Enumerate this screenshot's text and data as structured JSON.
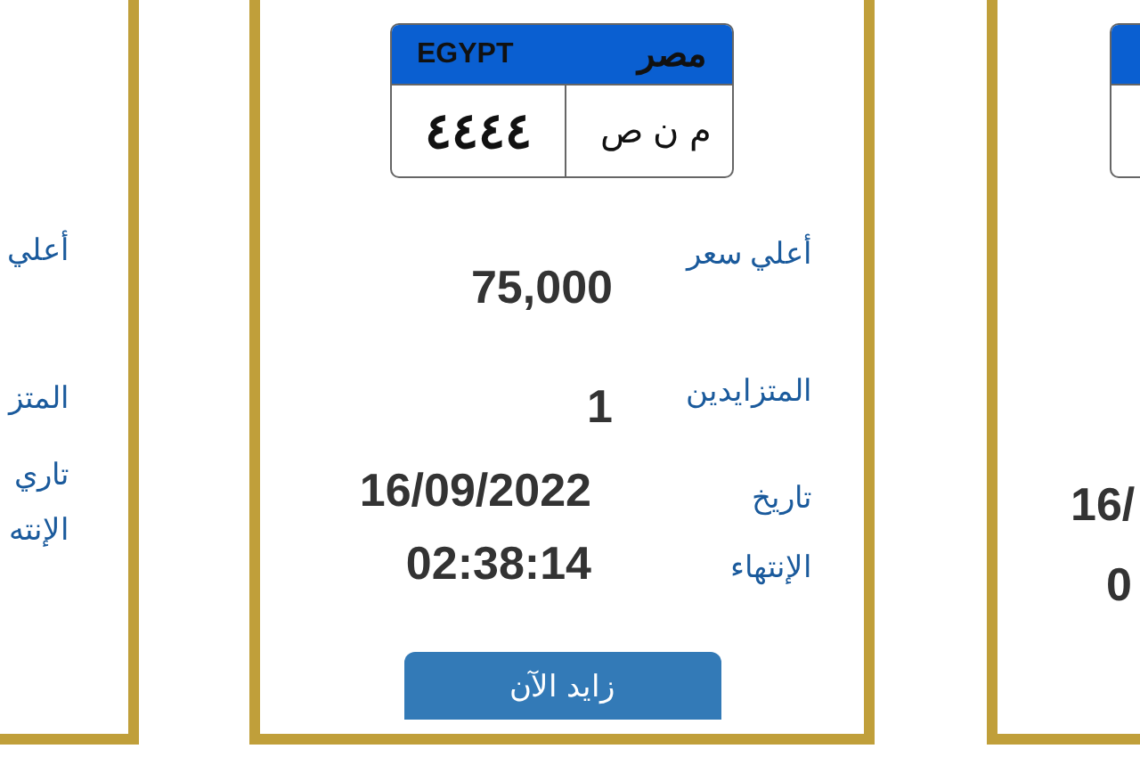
{
  "cards": [
    {
      "kind": "values-only",
      "values": [
        "16/",
        "0"
      ]
    },
    {
      "kind": "full",
      "plate": {
        "country_en": "EGYPT",
        "country_ar": "مصر",
        "number": "٤٤٤٤",
        "letters": "م ن ص"
      },
      "highest_bid_label": "أعلي سعر",
      "highest_bid": "75,000",
      "bidders_label": "المتزايدين",
      "bidders": "1",
      "expiry_label": "تاريخ الإنتهاء",
      "expiry_date": "16/09/2022",
      "expiry_time": "02:38:14",
      "button": "زايد الآن"
    },
    {
      "kind": "labels-only",
      "labels": [
        "أعلي",
        "المتز",
        "تاري",
        "الإنته"
      ]
    }
  ]
}
